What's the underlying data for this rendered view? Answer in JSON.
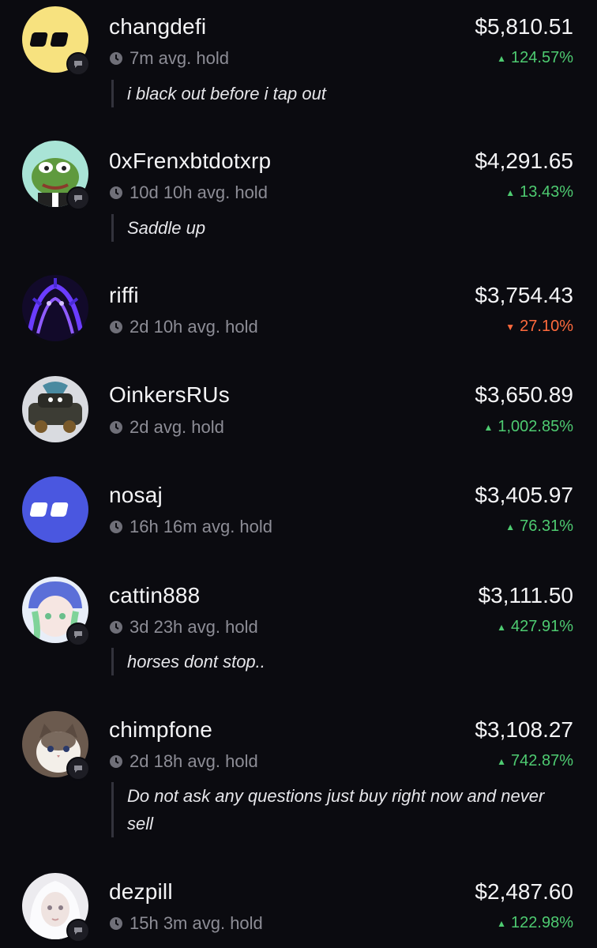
{
  "colors": {
    "background": "#0b0b10",
    "positive": "#4ecb71",
    "negative": "#ff6a3d",
    "muted": "#8d8d96"
  },
  "traders": [
    {
      "name": "changdefi",
      "hold": "7m avg. hold",
      "value": "$5,810.51",
      "change": "124.57%",
      "direction": "up",
      "quote": "i black out before i tap out",
      "avatar": "yellow-logo-avatar"
    },
    {
      "name": "0xFrenxbtdotxrp",
      "hold": "10d 10h avg. hold",
      "value": "$4,291.65",
      "change": "13.43%",
      "direction": "up",
      "quote": "Saddle up",
      "avatar": "frog-avatar"
    },
    {
      "name": "riffi",
      "hold": "2d 10h avg. hold",
      "value": "$3,754.43",
      "change": "27.10%",
      "direction": "down",
      "quote": "",
      "avatar": "purple-art-avatar"
    },
    {
      "name": "OinkersRUs",
      "hold": "2d avg. hold",
      "value": "$3,650.89",
      "change": "1,002.85%",
      "direction": "up",
      "quote": "",
      "avatar": "car-avatar"
    },
    {
      "name": "nosaj",
      "hold": "16h 16m avg. hold",
      "value": "$3,405.97",
      "change": "76.31%",
      "direction": "up",
      "quote": "",
      "avatar": "blue-logo-avatar"
    },
    {
      "name": "cattin888",
      "hold": "3d 23h avg. hold",
      "value": "$3,111.50",
      "change": "427.91%",
      "direction": "up",
      "quote": "horses dont stop..",
      "avatar": "anime-avatar"
    },
    {
      "name": "chimpfone",
      "hold": "2d 18h avg. hold",
      "value": "$3,108.27",
      "change": "742.87%",
      "direction": "up",
      "quote": "Do not ask any questions just buy right now and never sell",
      "avatar": "cat-avatar"
    },
    {
      "name": "dezpill",
      "hold": "15h 3m avg. hold",
      "value": "$2,487.60",
      "change": "122.98%",
      "direction": "up",
      "quote": "",
      "avatar": "doll-avatar"
    }
  ]
}
